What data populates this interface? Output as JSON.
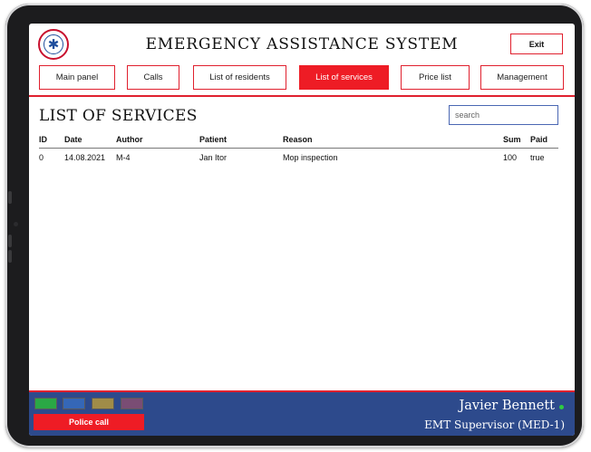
{
  "app": {
    "title": "EMERGENCY ASSISTANCE SYSTEM",
    "exit_label": "Exit"
  },
  "nav": {
    "items": [
      {
        "label": "Main panel"
      },
      {
        "label": "Calls"
      },
      {
        "label": "List of residents"
      },
      {
        "label": "List of services",
        "active": true
      },
      {
        "label": "Price list"
      },
      {
        "label": "Management"
      }
    ]
  },
  "page": {
    "heading": "LIST OF SERVICES",
    "search_placeholder": "search",
    "search_value": ""
  },
  "table": {
    "columns": [
      "ID",
      "Date",
      "Author",
      "Patient",
      "Reason",
      "Sum",
      "Paid"
    ],
    "rows": [
      [
        "0",
        "14.08.2021",
        "M-4",
        "Jan Itor",
        "Mop inspection",
        "100",
        "true"
      ]
    ]
  },
  "footer": {
    "swatches": [
      "#2aa845",
      "#3567b7",
      "#a08c48",
      "#7a4d74"
    ],
    "police_call_label": "Police call",
    "user_name": "Javier Bennett",
    "user_role": "EMT Supervisor (MED-1)",
    "status_color": "#2ecc40"
  },
  "colors": {
    "accent": "#ee1c25",
    "footer": "#2d4a8c"
  }
}
